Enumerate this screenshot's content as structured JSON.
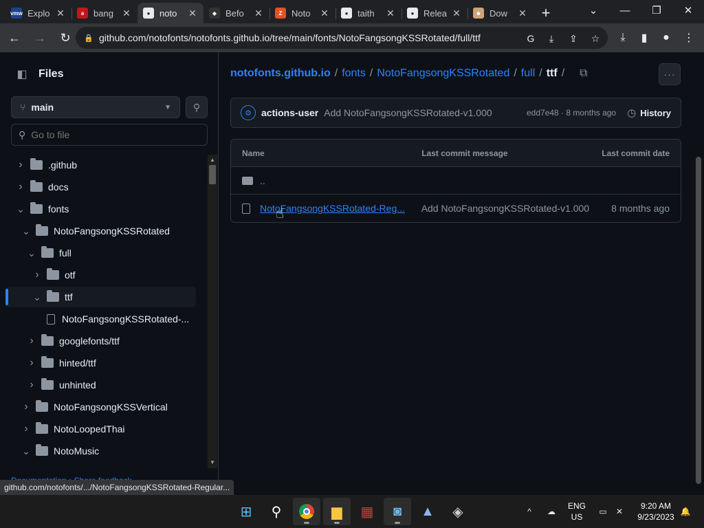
{
  "browser": {
    "tabs": [
      {
        "title": "Explo",
        "icon": "vmware-icon",
        "color": "#1d428a",
        "glyph": "vmw"
      },
      {
        "title": "bang",
        "icon": "bookmark-red-icon",
        "color": "#c4161c",
        "glyph": "ǝ"
      },
      {
        "title": "noto",
        "icon": "github-icon",
        "color": "#e8eaed",
        "glyph": "●",
        "active": true
      },
      {
        "title": "Befo",
        "icon": "shield-icon",
        "color": "#333333",
        "glyph": "◆"
      },
      {
        "title": "Noto",
        "icon": "colorful-z-icon",
        "color": "#e94e2a",
        "glyph": "Z"
      },
      {
        "title": "taith",
        "icon": "github-icon",
        "color": "#e8eaed",
        "glyph": "●"
      },
      {
        "title": "Relea",
        "icon": "github-icon",
        "color": "#e8eaed",
        "glyph": "●"
      },
      {
        "title": "Dow",
        "icon": "cat-icon",
        "color": "#cfa27a",
        "glyph": "☻"
      }
    ],
    "url": "github.com/notofonts/notofonts.github.io/tree/main/fonts/NotoFangsongKSSRotated/full/ttf",
    "status_url": "github.com/notofonts/.../NotoFangsongKSSRotated-Regular..."
  },
  "sidebar": {
    "title": "Files",
    "branch": "main",
    "goto_placeholder": "Go to file",
    "tree": [
      {
        "label": ".github",
        "type": "folder",
        "depth": 0,
        "expanded": false
      },
      {
        "label": "docs",
        "type": "folder",
        "depth": 0,
        "expanded": false
      },
      {
        "label": "fonts",
        "type": "folder",
        "depth": 0,
        "expanded": true
      },
      {
        "label": "NotoFangsongKSSRotated",
        "type": "folder",
        "depth": 1,
        "expanded": true
      },
      {
        "label": "full",
        "type": "folder",
        "depth": 2,
        "expanded": true
      },
      {
        "label": "otf",
        "type": "folder",
        "depth": 3,
        "expanded": false
      },
      {
        "label": "ttf",
        "type": "folder",
        "depth": 3,
        "expanded": true,
        "selected": true
      },
      {
        "label": "NotoFangsongKSSRotated-...",
        "type": "file",
        "depth": 4
      },
      {
        "label": "googlefonts/ttf",
        "type": "folder",
        "depth": 2,
        "expanded": false
      },
      {
        "label": "hinted/ttf",
        "type": "folder",
        "depth": 2,
        "expanded": false
      },
      {
        "label": "unhinted",
        "type": "folder",
        "depth": 2,
        "expanded": false
      },
      {
        "label": "NotoFangsongKSSVertical",
        "type": "folder",
        "depth": 1,
        "expanded": false
      },
      {
        "label": "NotoLoopedThai",
        "type": "folder",
        "depth": 1,
        "expanded": false
      },
      {
        "label": "NotoMusic",
        "type": "folder",
        "depth": 1,
        "expanded": true
      }
    ],
    "footer": "Documentation • Share feedback"
  },
  "breadcrumb": {
    "repo": "notofonts.github.io",
    "parts": [
      "fonts",
      "NotoFangsongKSSRotated",
      "full"
    ],
    "current": "ttf",
    "trailing": "/"
  },
  "commit": {
    "author": "actions-user",
    "message": "Add NotoFangsongKSSRotated-v1.000",
    "meta": "edd7e48 · 8 months ago",
    "history_label": "History"
  },
  "table": {
    "headers": {
      "name": "Name",
      "message": "Last commit message",
      "date": "Last commit date"
    },
    "parent": "..",
    "rows": [
      {
        "name": "NotoFangsongKSSRotated-Reg...",
        "message": "Add NotoFangsongKSSRotated-v1.000",
        "date": "8 months ago"
      }
    ]
  },
  "taskbar": {
    "lang": "ENG",
    "region": "US",
    "time": "9:20 AM",
    "date": "9/23/2023"
  }
}
